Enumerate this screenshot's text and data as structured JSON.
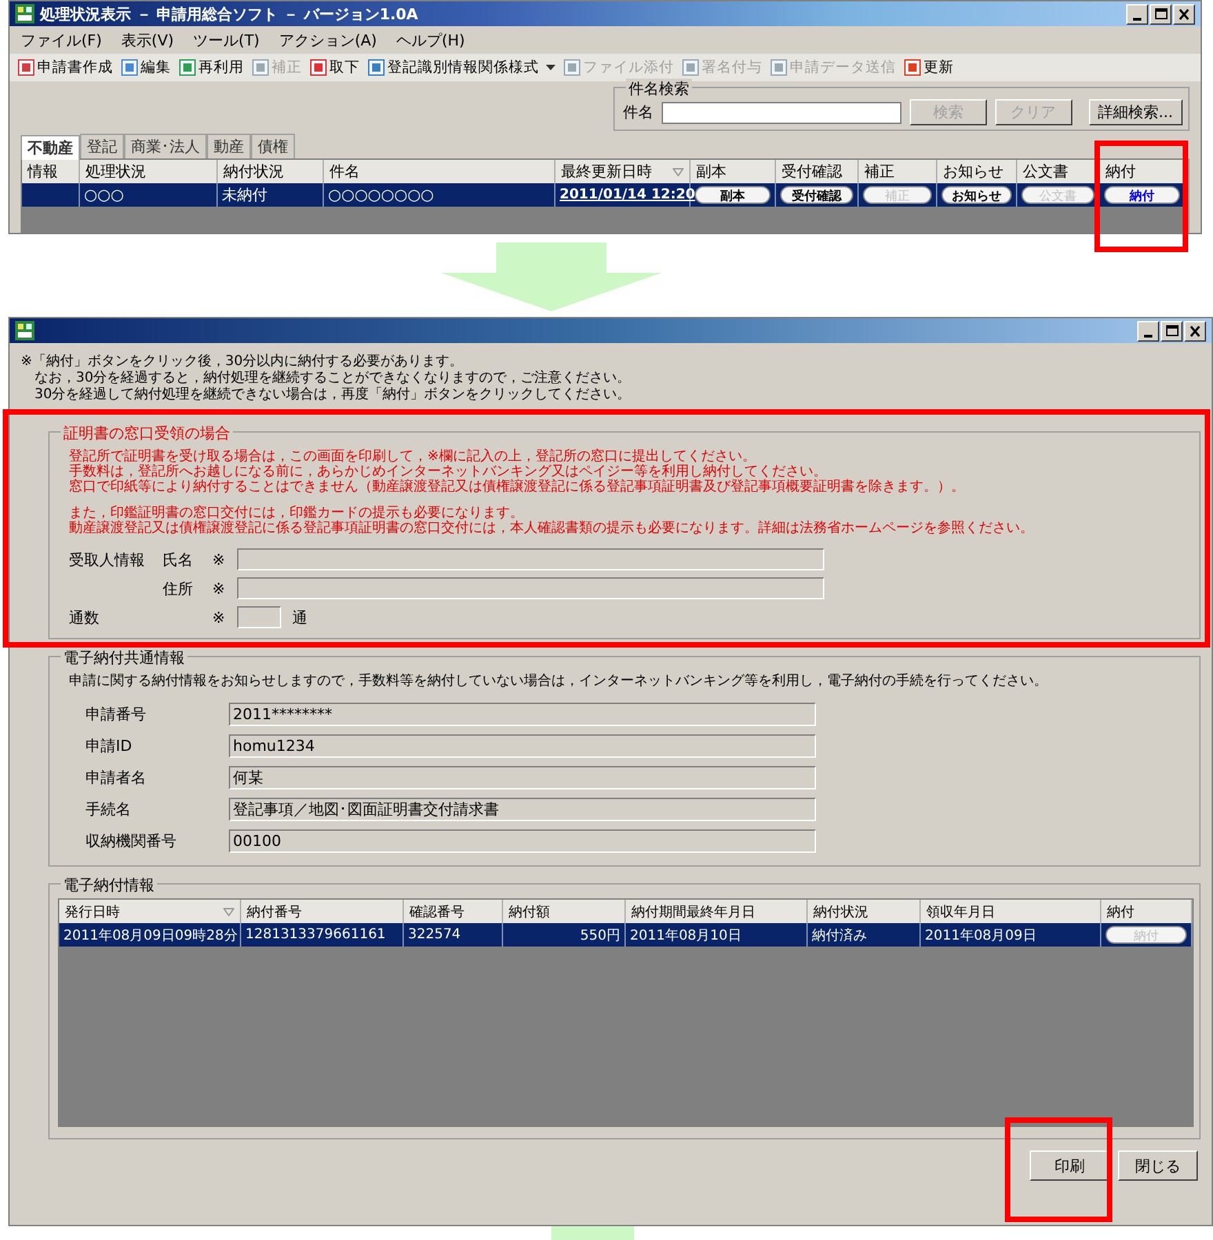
{
  "main_window": {
    "title": "処理状況表示 － 申請用総合ソフト － バージョン1.0A",
    "menu": [
      "ファイル(F)",
      "表示(V)",
      "ツール(T)",
      "アクション(A)",
      "ヘルプ(H)"
    ],
    "toolbar": [
      {
        "label": "申請書作成",
        "disabled": false,
        "dropdown": false,
        "color": "#d04040"
      },
      {
        "label": "編集",
        "disabled": false,
        "dropdown": false,
        "color": "#4a8ad0"
      },
      {
        "label": "再利用",
        "disabled": false,
        "dropdown": false,
        "color": "#30a050"
      },
      {
        "label": "補正",
        "disabled": true,
        "dropdown": false,
        "color": "#9aa8b0"
      },
      {
        "label": "取下",
        "disabled": false,
        "dropdown": false,
        "color": "#e03030"
      },
      {
        "label": "登記識別情報関係様式",
        "disabled": false,
        "dropdown": true,
        "color": "#3a80c0"
      },
      {
        "label": "ファイル添付",
        "disabled": true,
        "dropdown": false,
        "color": "#9aa8b0"
      },
      {
        "label": "署名付与",
        "disabled": true,
        "dropdown": false,
        "color": "#9aa8b0"
      },
      {
        "label": "申請データ送信",
        "disabled": true,
        "dropdown": false,
        "color": "#9aa8b0"
      },
      {
        "label": "更新",
        "disabled": false,
        "dropdown": false,
        "color": "#e04020"
      }
    ],
    "search": {
      "legend": "件名検索",
      "label": "件名",
      "buttons": [
        {
          "label": "検索",
          "disabled": true
        },
        {
          "label": "クリア",
          "disabled": true
        },
        {
          "label": "詳細検索...",
          "disabled": false
        }
      ]
    },
    "tabs": [
      {
        "label": "不動産",
        "selected": true
      },
      {
        "label": "登記",
        "selected": false
      },
      {
        "label": "商業･法人",
        "selected": false
      },
      {
        "label": "動産",
        "selected": false
      },
      {
        "label": "債権",
        "selected": false
      }
    ],
    "table": {
      "columns": [
        {
          "label": "情報",
          "sorted": false,
          "highlighted": false
        },
        {
          "label": "処理状況",
          "sorted": false,
          "highlighted": false
        },
        {
          "label": "納付状況",
          "sorted": false,
          "highlighted": false
        },
        {
          "label": "件名",
          "sorted": false,
          "highlighted": false
        },
        {
          "label": "最終更新日時",
          "sorted": true,
          "highlighted": false
        },
        {
          "label": "副本",
          "sorted": false,
          "highlighted": false
        },
        {
          "label": "受付確認",
          "sorted": false,
          "highlighted": false
        },
        {
          "label": "補正",
          "sorted": false,
          "highlighted": false
        },
        {
          "label": "お知らせ",
          "sorted": false,
          "highlighted": false
        },
        {
          "label": "公文書",
          "sorted": false,
          "highlighted": false
        },
        {
          "label": "納付",
          "sorted": false,
          "highlighted": true
        }
      ],
      "rows": [
        {
          "selected": true,
          "cells": [
            {
              "kind": "blank"
            },
            {
              "kind": "text",
              "text": "○○○"
            },
            {
              "kind": "text",
              "text": "未納付"
            },
            {
              "kind": "text",
              "text": "○○○○○○○○"
            },
            {
              "kind": "link",
              "text": "2011/01/14 12:20"
            },
            {
              "kind": "button",
              "text": "副本",
              "disabled": false
            },
            {
              "kind": "button",
              "text": "受付確認",
              "disabled": false
            },
            {
              "kind": "button",
              "text": "補正",
              "disabled": true
            },
            {
              "kind": "button",
              "text": "お知らせ",
              "disabled": false
            },
            {
              "kind": "button",
              "text": "公文書",
              "disabled": true
            },
            {
              "kind": "button",
              "text": "納付",
              "disabled": false,
              "accent": true
            }
          ]
        }
      ]
    }
  },
  "payment_window": {
    "notice": [
      "※「納付」ボタンをクリック後，30分以内に納付する必要があります。",
      "　なお，30分を経過すると，納付処理を継続することができなくなりますので，ご注意ください。",
      "　30分を経過して納付処理を継続できない場合は，再度「納付」ボタンをクリックしてください。"
    ],
    "pickup": {
      "legend": "証明書の窓口受領の場合",
      "highlighted": true,
      "paragraphs": [
        [
          "登記所で証明書を受け取る場合は，この画面を印刷して，※欄に記入の上，登記所の窓口に提出してください。",
          "手数料は，登記所へお越しになる前に，あらかじめインターネットバンキング又はペイジー等を利用し納付してください。",
          "窓口で印紙等により納付することはできません（動産譲渡登記又は債権譲渡登記に係る登記事項証明書及び登記事項概要証明書を除きます。）。"
        ],
        [
          "また，印鑑証明書の窓口交付には，印鑑カードの提示も必要になります。",
          "動産譲渡登記又は債権譲渡登記に係る登記事項証明書の窓口交付には，本人確認書類の提示も必要になります。詳細は法務省ホームページを参照ください。"
        ]
      ],
      "recipient_label": "受取人情報",
      "fields": [
        {
          "label": "氏名",
          "mark": "※"
        },
        {
          "label": "住所",
          "mark": "※"
        }
      ],
      "copies": {
        "label": "通数",
        "mark": "※",
        "unit": "通"
      }
    },
    "common": {
      "legend": "電子納付共通情報",
      "description": "申請に関する納付情報をお知らせしますので，手数料等を納付していない場合は，インターネットバンキング等を利用し，電子納付の手続を行ってください。",
      "fields": [
        {
          "label": "申請番号",
          "value": "2011********"
        },
        {
          "label": "申請ID",
          "value": "homu1234"
        },
        {
          "label": "申請者名",
          "value": "何某"
        },
        {
          "label": "手続名",
          "value": "登記事項／地図･図面証明書交付請求書"
        },
        {
          "label": "収納機関番号",
          "value": "00100"
        }
      ]
    },
    "payment": {
      "legend": "電子納付情報",
      "columns": [
        {
          "label": "発行日時",
          "sorted": true
        },
        {
          "label": "納付番号",
          "sorted": false
        },
        {
          "label": "確認番号",
          "sorted": false
        },
        {
          "label": "納付額",
          "sorted": false
        },
        {
          "label": "納付期間最終年月日",
          "sorted": false
        },
        {
          "label": "納付状況",
          "sorted": false
        },
        {
          "label": "領収年月日",
          "sorted": false
        },
        {
          "label": "納付",
          "sorted": false
        }
      ],
      "rows": [
        {
          "selected": true,
          "cells": [
            {
              "kind": "text",
              "text": "2011年08月09日09時28分"
            },
            {
              "kind": "text",
              "text": "1281313379661161"
            },
            {
              "kind": "text",
              "text": "322574"
            },
            {
              "kind": "amount",
              "text": "550円"
            },
            {
              "kind": "text",
              "text": "2011年08月10日"
            },
            {
              "kind": "text",
              "text": "納付済み"
            },
            {
              "kind": "text",
              "text": "2011年08月09日"
            },
            {
              "kind": "button",
              "text": "納付",
              "disabled": true
            }
          ]
        }
      ]
    },
    "buttons": [
      {
        "label": "印刷",
        "highlighted": true
      },
      {
        "label": "閉じる",
        "highlighted": false
      }
    ]
  }
}
